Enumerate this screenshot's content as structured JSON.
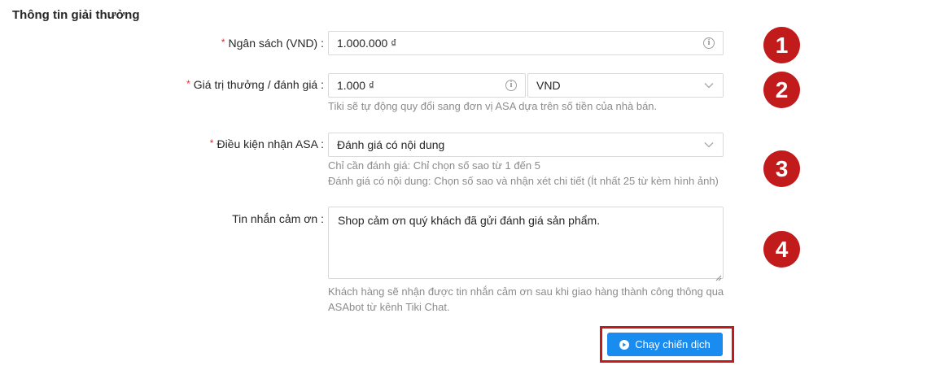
{
  "section": {
    "title": "Thông tin giải thưởng"
  },
  "budget": {
    "label": "Ngân sách (VND) :",
    "value": "1.000.000 ₫"
  },
  "reward_value": {
    "label": "Giá trị thưởng / đánh giá :",
    "value": "1.000 ₫",
    "currency": "VND",
    "help": "Tiki sẽ tự động quy đổi sang đơn vị ASA dựa trên số tiền của nhà bán."
  },
  "condition": {
    "label": "Điều kiện nhận ASA :",
    "value": "Đánh giá có nội dung",
    "help_1": "Chỉ cần đánh giá: Chỉ chọn số sao từ 1 đến 5",
    "help_2": "Đánh giá có nội dung: Chọn số sao và nhận xét chi tiết (Ít nhất 25 từ kèm hình ảnh)"
  },
  "thank_message": {
    "label": "Tin nhắn cảm ơn :",
    "value": "Shop cảm ơn quý khách đã gửi đánh giá sản phẩm.",
    "help_1": "Khách hàng sẽ nhận được tin nhắn cảm ơn sau khi giao hàng thành công thông qua",
    "help_2": "ASAbot từ kênh Tiki Chat."
  },
  "run_button": {
    "label": "Chạy chiến dịch"
  },
  "markers": [
    "1",
    "2",
    "3",
    "4"
  ],
  "colors": {
    "required": "#e0282e",
    "primary": "#1a8cf0",
    "marker": "#c21b1c",
    "help_text": "#8c8c8c"
  },
  "icons": {
    "info": "info-icon",
    "dropdown": "chevron-down-icon",
    "run": "play-circle-icon"
  }
}
